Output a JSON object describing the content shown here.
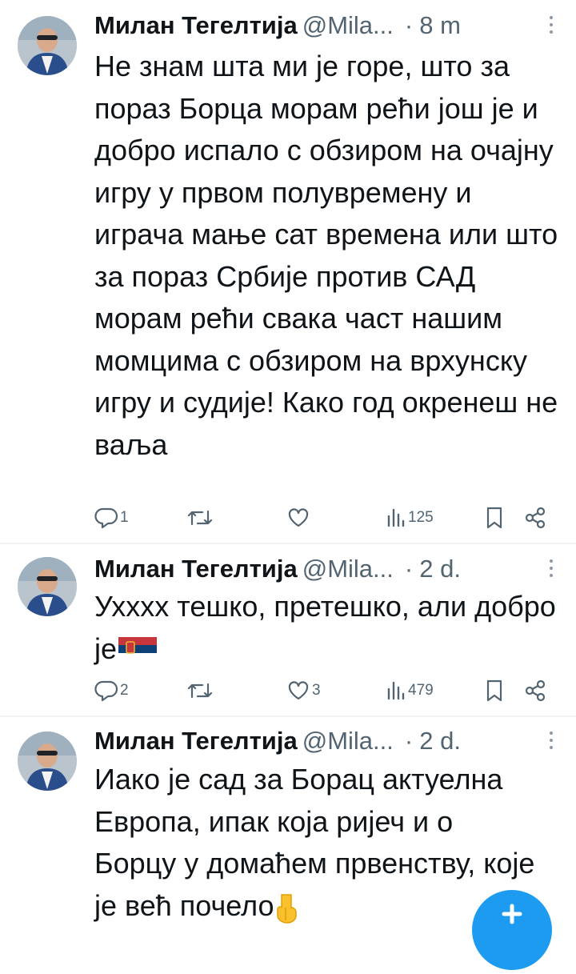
{
  "tweets": [
    {
      "author_name": "Милан Тегелтија",
      "handle": "@Mila...",
      "separator": "·",
      "time": "8 m",
      "text": "Не знам шта ми је горе, што за пораз Борца морам рећи још је и добро испало с обзиром на очајну игру у првом полувремену и играча мање сат времена или што за пораз Србије против САД  морам рећи свака част нашим момцима с обзиром на врхунску игру и судије! Како год окренеш не ваља",
      "replies": "1",
      "retweets": "",
      "likes": "",
      "views": "125"
    },
    {
      "author_name": "Милан Тегелтија",
      "handle": "@Mila...",
      "separator": "·",
      "time": "2 d.",
      "text": "Ухххх тешко, претешко, али добро је",
      "emoji": "serbia-flag",
      "replies": "2",
      "retweets": "",
      "likes": "3",
      "views": "479"
    },
    {
      "author_name": "Милан Тегелтија",
      "handle": "@Mila...",
      "separator": "·",
      "time": "2 d.",
      "text": "Иако  је сад за Борац актуелна Европа, ипак која ријеч и о Борцу у домаћем првенству, које је већ почело",
      "emoji": "pointing-down-hand"
    }
  ],
  "icons": {
    "reply": "reply-icon",
    "retweet": "retweet-icon",
    "like": "heart-icon",
    "views": "views-icon",
    "bookmark": "bookmark-icon",
    "share": "share-icon",
    "more": "more-icon",
    "compose": "compose-icon"
  },
  "colors": {
    "text": "#0f1419",
    "secondary": "#536471",
    "divider": "#eff3f4",
    "accent": "#1d9bf0"
  }
}
